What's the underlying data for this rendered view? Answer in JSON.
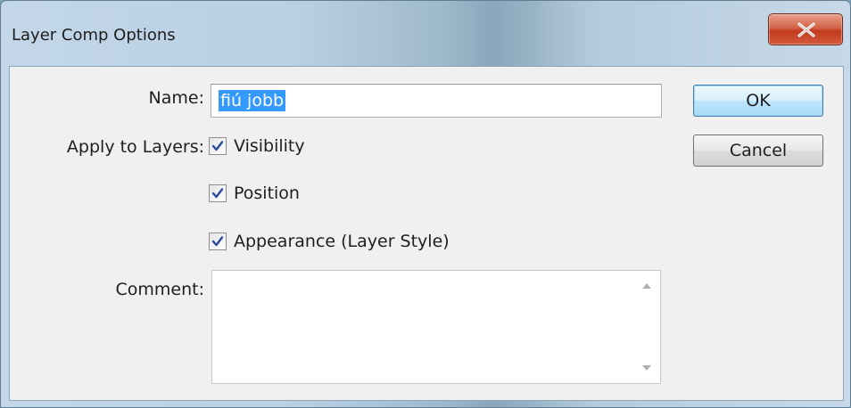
{
  "window": {
    "title": "Layer Comp Options",
    "close_icon": "close-icon"
  },
  "form": {
    "name_label": "Name:",
    "name_value": "fiú jobb",
    "apply_label": "Apply to Layers:",
    "checkboxes": [
      {
        "label": "Visibility",
        "checked": true
      },
      {
        "label": "Position",
        "checked": true
      },
      {
        "label": "Appearance (Layer Style)",
        "checked": true
      }
    ],
    "comment_label": "Comment:",
    "comment_value": ""
  },
  "buttons": {
    "ok": "OK",
    "cancel": "Cancel"
  },
  "colors": {
    "selection": "#3399ff",
    "close_button": "#c8402a",
    "default_button_border": "#3c7fb1"
  }
}
